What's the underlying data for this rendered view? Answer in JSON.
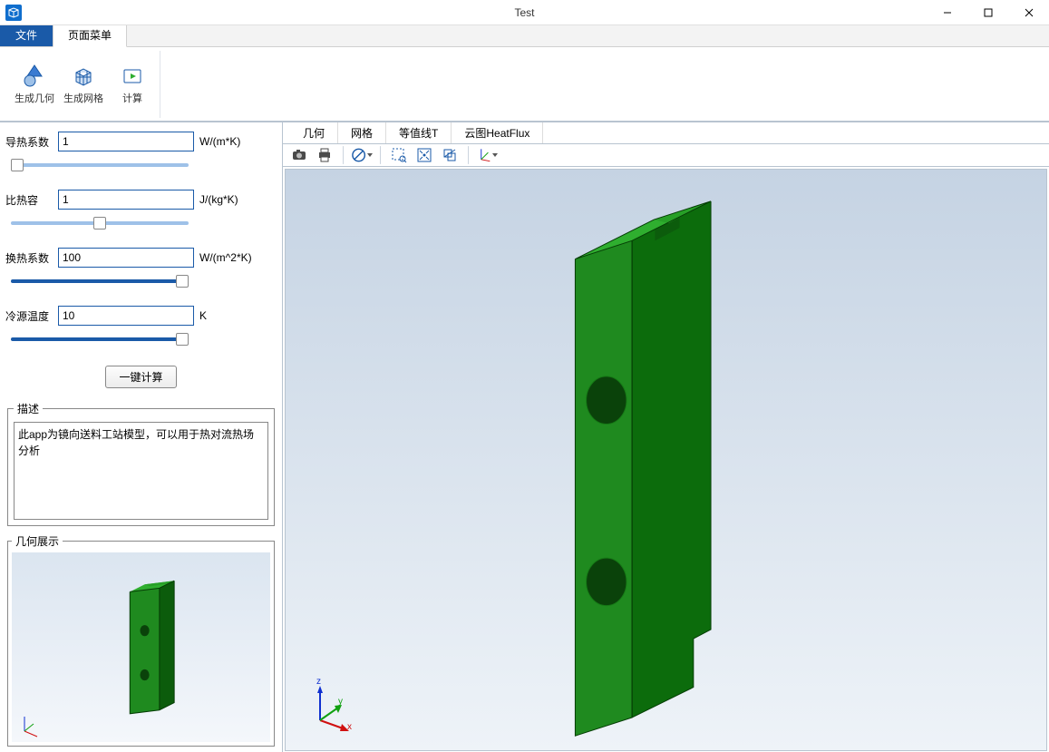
{
  "window": {
    "title": "Test"
  },
  "filetabs": {
    "primary": "文件",
    "page_menu": "页面菜单"
  },
  "ribbon": {
    "gen_geom": "生成几何",
    "gen_mesh": "生成网格",
    "compute": "计算"
  },
  "params": {
    "conductivity": {
      "label": "导热系数",
      "value": "1",
      "unit": "W/(m*K)"
    },
    "heat_capacity": {
      "label": "比热容",
      "value": "1",
      "unit": "J/(kg*K)"
    },
    "htc": {
      "label": "换热系数",
      "value": "100",
      "unit": "W/(m^2*K)"
    },
    "cold_temp": {
      "label": "冷源温度",
      "value": "10",
      "unit": "K"
    }
  },
  "calc_button": "一键计算",
  "description": {
    "legend": "描述",
    "text": "此app为镜向送料工站模型，可以用于热对流热场分析"
  },
  "geom_preview_legend": "几何展示",
  "view_tabs": {
    "geom": "几何",
    "mesh": "网格",
    "contour": "等值线T",
    "cloud": "云图HeatFlux"
  },
  "toolbar_icons": {
    "camera": "camera-icon",
    "print": "print-icon",
    "forbid": "no-entry-icon",
    "zoom_rect": "zoom-rect-icon",
    "fit": "fit-view-icon",
    "transparency": "transparency-icon",
    "axes": "axes-icon"
  },
  "axis_labels": {
    "x": "x",
    "y": "y",
    "z": "z"
  }
}
